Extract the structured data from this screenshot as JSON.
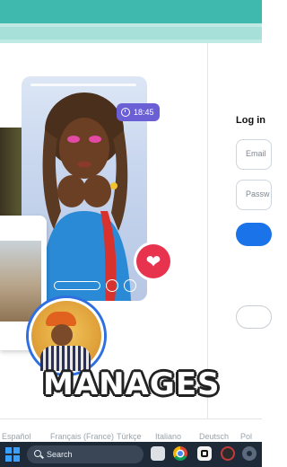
{
  "hero": {
    "timer": "18:45",
    "caption": "MANAGES"
  },
  "login": {
    "title": "Log in",
    "email_placeholder": "Email",
    "password_placeholder": "Passw"
  },
  "languages": [
    "Español",
    "Français (France)",
    "Türkçe",
    "Italiano",
    "Deutsch",
    "Pol"
  ],
  "taskbar": {
    "search_label": "Search"
  },
  "colors": {
    "brand_teal": "#3fb8ad",
    "login_button": "#1a73e8",
    "heart": "#e8334f",
    "timer_pill": "#6b5fd6"
  }
}
